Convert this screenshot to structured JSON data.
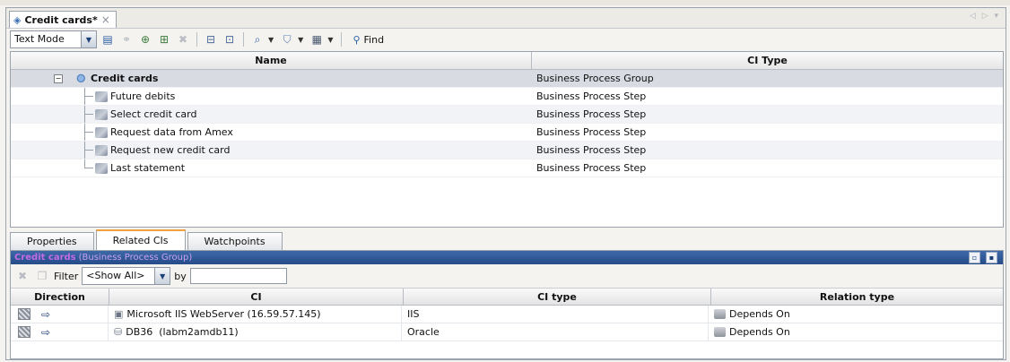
{
  "editor": {
    "tab_title": "Credit cards*",
    "close": "×",
    "nav": "◁ ▷ ▾"
  },
  "toolbar": {
    "mode": "Text Mode",
    "find_label": "Find",
    "icons": [
      "properties-icon",
      "link-icon",
      "add-ci-icon",
      "add-related-icon",
      "delete-icon",
      "tree-expand-icon",
      "tree-collapse-icon",
      "search-icon",
      "filter-icon",
      "layout-icon",
      "magnifier-icon"
    ]
  },
  "tree": {
    "columns": [
      "Name",
      "CI Type"
    ],
    "root": {
      "name": "Credit cards",
      "type": "Business Process Group"
    },
    "children": [
      {
        "name": "Future debits",
        "type": "Business Process Step"
      },
      {
        "name": "Select credit card",
        "type": "Business Process Step"
      },
      {
        "name": "Request data from Amex",
        "type": "Business Process Step"
      },
      {
        "name": "Request new credit card",
        "type": "Business Process Step"
      },
      {
        "name": "Last statement",
        "type": "Business Process Step"
      }
    ]
  },
  "lower_tabs": [
    "Properties",
    "Related CIs",
    "Watchpoints"
  ],
  "context": {
    "name": "Credit cards",
    "type": "(Business Process Group)"
  },
  "filter": {
    "label": "Filter",
    "value": "<Show All>",
    "by_label": "by",
    "by_value": ""
  },
  "related": {
    "columns": [
      "Direction",
      "CI",
      "CI type",
      "Relation type"
    ],
    "rows": [
      {
        "ci": "Microsoft IIS WebServer (16.59.57.145)",
        "ci_type": "IIS",
        "relation": "Depends On"
      },
      {
        "ci": "DB36  (labm2amdb11)",
        "ci_type": "Oracle",
        "relation": "Depends On"
      }
    ]
  },
  "colors": {
    "accent_tab": "#f0a040",
    "context_bar": "#2f5a98",
    "context_text": "#c36be5",
    "selected_row": "#d9dbe3"
  }
}
